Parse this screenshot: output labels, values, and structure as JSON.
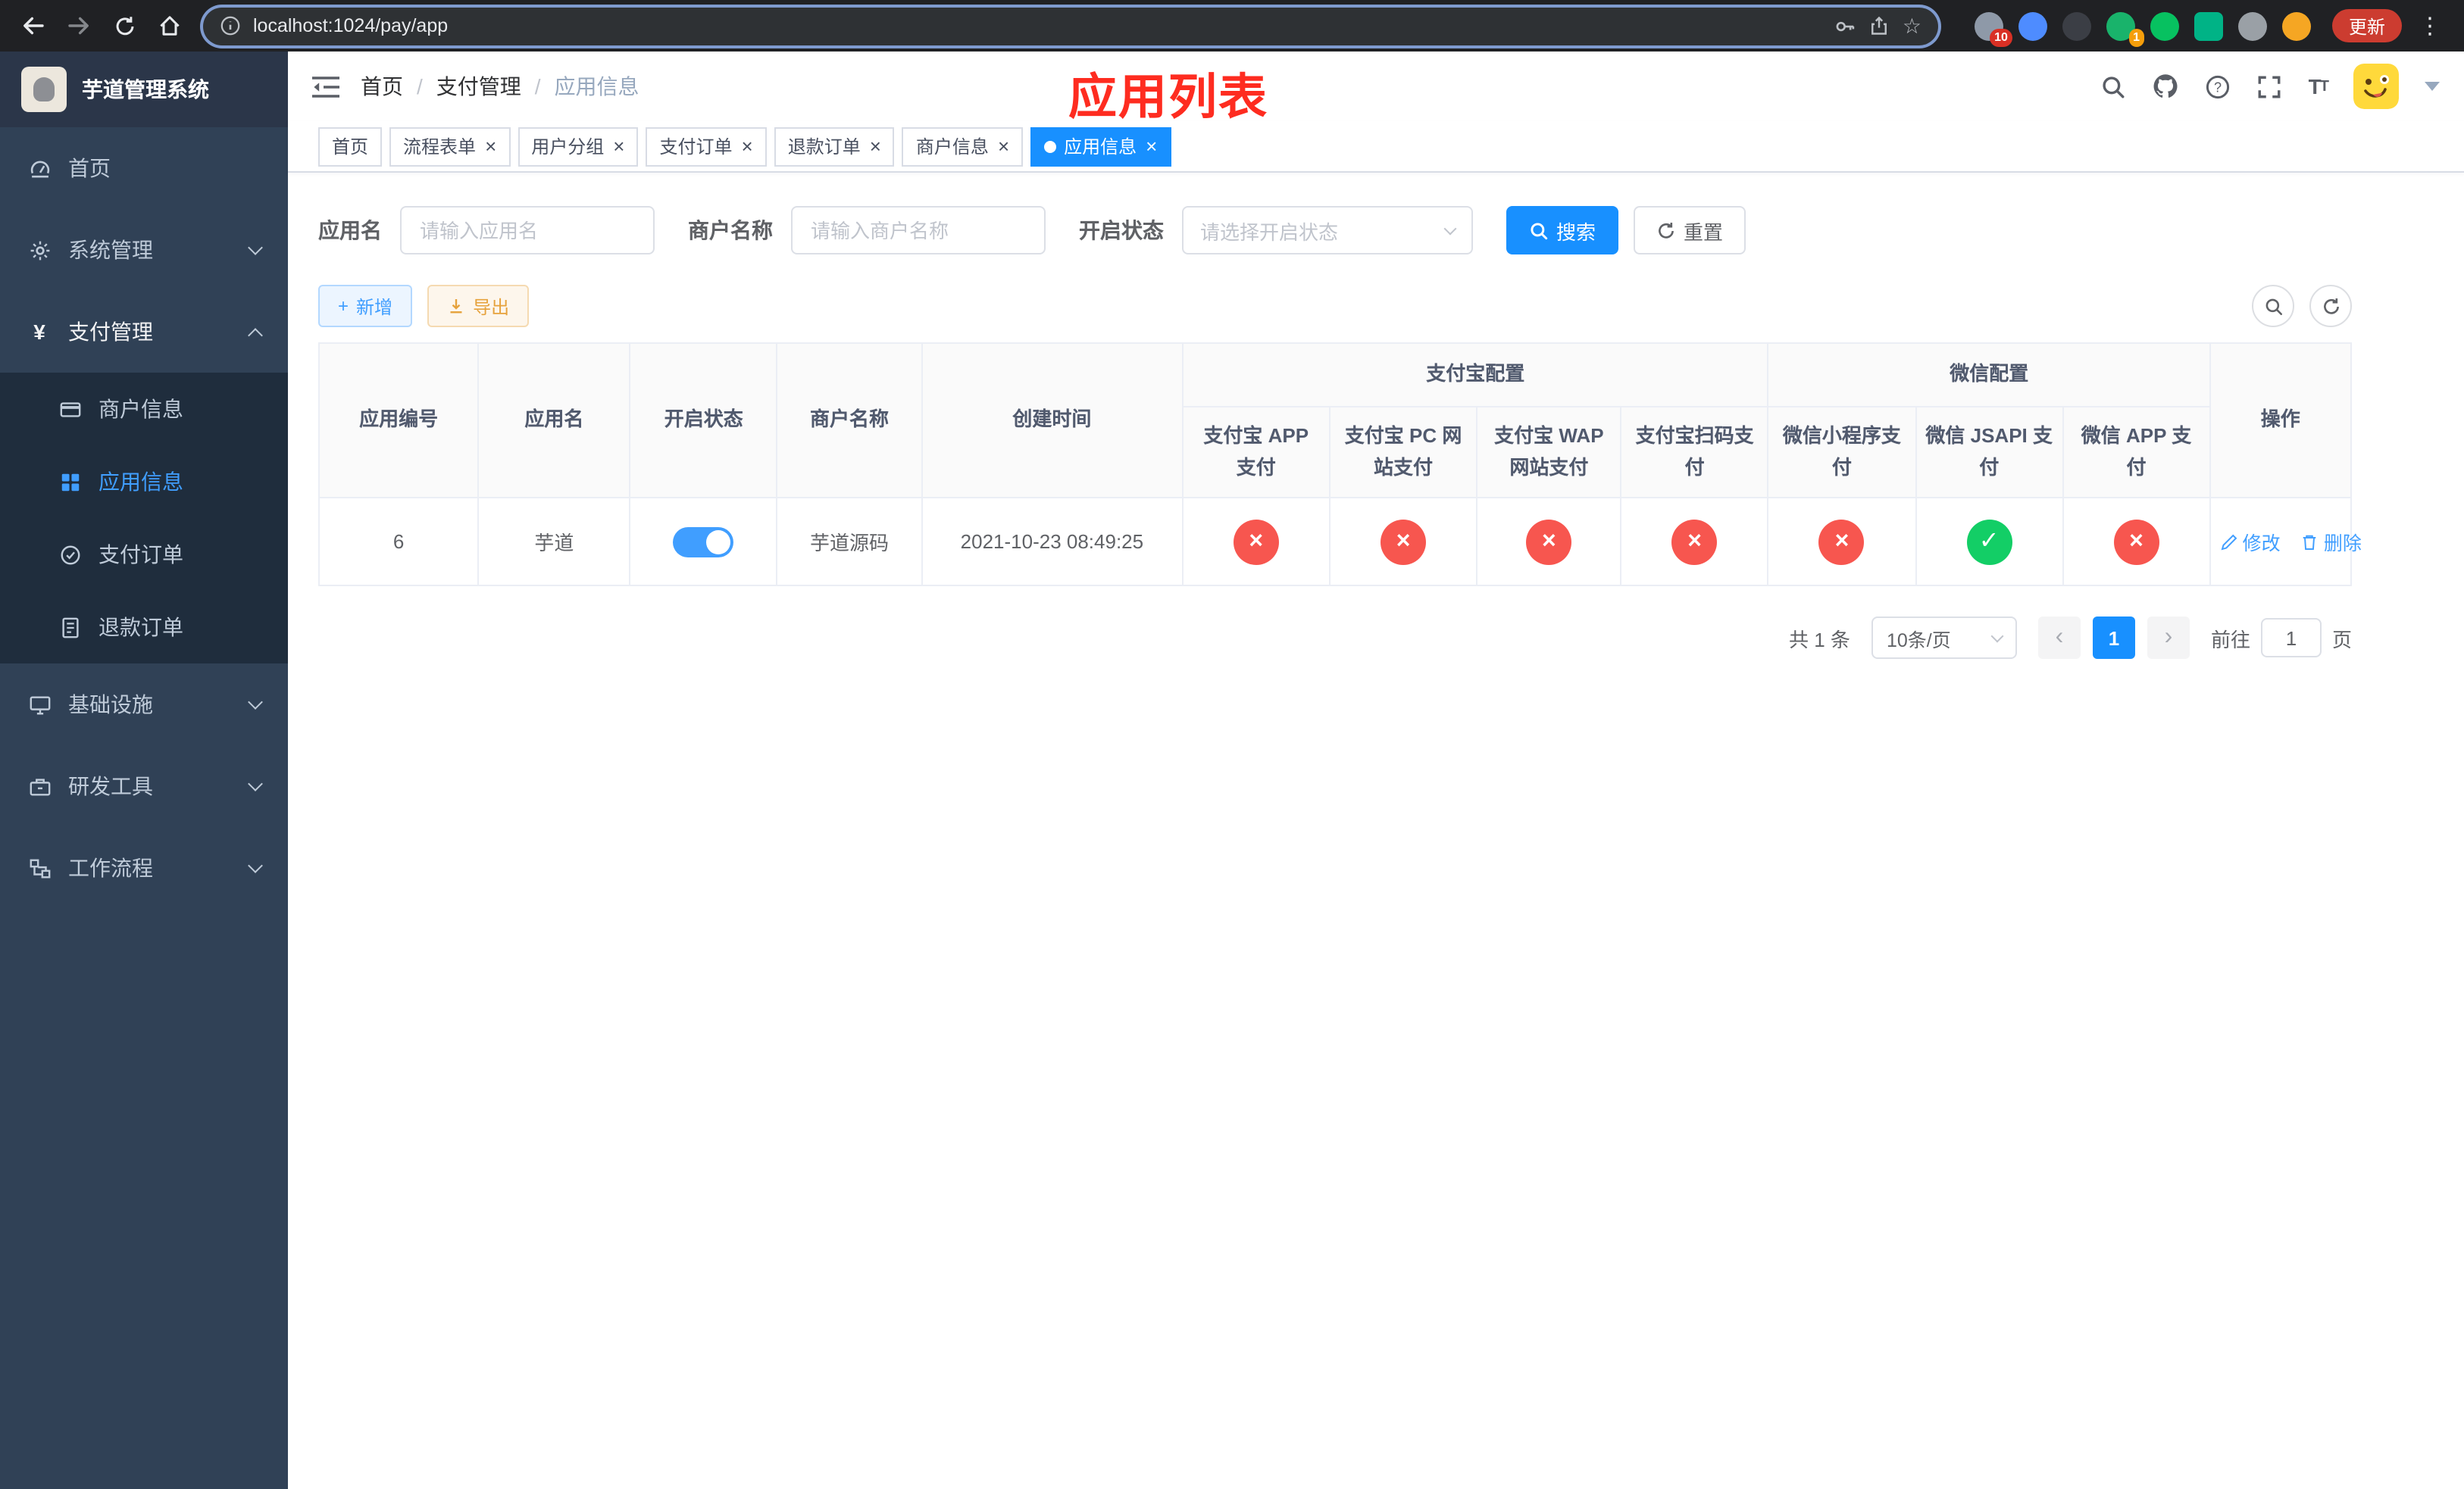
{
  "colors": {
    "primary": "#1890ff",
    "link": "#409eff",
    "success": "#13ce66",
    "danger": "#f7564f",
    "warning": "#e6a23c",
    "title_red": "#fe2c20",
    "sidebar_bg": "#304156",
    "submenu_bg": "#1f2d3d"
  },
  "browser": {
    "url": "localhost:1024/pay/app",
    "update_button": "更新",
    "extensions_badge": "10",
    "profile_badge": "1"
  },
  "app_title": "芋道管理系统",
  "sidebar": {
    "home": "首页",
    "system": "系统管理",
    "pay": "支付管理",
    "pay_children": {
      "merchant": "商户信息",
      "app": "应用信息",
      "order": "支付订单",
      "refund": "退款订单"
    },
    "infra": "基础设施",
    "devtool": "研发工具",
    "workflow": "工作流程"
  },
  "navbar": {
    "breadcrumb": [
      "首页",
      "支付管理",
      "应用信息"
    ],
    "page_title": "应用列表"
  },
  "tabs": [
    {
      "label": "首页",
      "active": false,
      "closable": false
    },
    {
      "label": "流程表单",
      "active": false,
      "closable": true
    },
    {
      "label": "用户分组",
      "active": false,
      "closable": true
    },
    {
      "label": "支付订单",
      "active": false,
      "closable": true
    },
    {
      "label": "退款订单",
      "active": false,
      "closable": true
    },
    {
      "label": "商户信息",
      "active": false,
      "closable": true
    },
    {
      "label": "应用信息",
      "active": true,
      "closable": true
    }
  ],
  "filters": {
    "app_name_label": "应用名",
    "app_name_placeholder": "请输入应用名",
    "app_name_value": "",
    "merchant_label": "商户名称",
    "merchant_placeholder": "请输入商户名称",
    "merchant_value": "",
    "status_label": "开启状态",
    "status_placeholder": "请选择开启状态",
    "search_button": "搜索",
    "reset_button": "重置"
  },
  "toolbar": {
    "add_button": "新增",
    "export_button": "导出"
  },
  "table": {
    "headers": {
      "app_id": "应用编号",
      "app_name": "应用名",
      "status": "开启状态",
      "merchant_name": "商户名称",
      "create_time": "创建时间",
      "alipay_group": "支付宝配置",
      "wechat_group": "微信配置",
      "alipay_app": "支付宝 APP 支付",
      "alipay_pc": "支付宝 PC 网站支付",
      "alipay_wap": "支付宝 WAP 网站支付",
      "alipay_qr": "支付宝扫码支付",
      "wx_mini": "微信小程序支付",
      "wx_jsapi": "微信 JSAPI 支付",
      "wx_app": "微信 APP 支付",
      "actions": "操作"
    },
    "rows": [
      {
        "app_id": "6",
        "app_name": "芋道",
        "status": "on",
        "merchant_name": "芋道源码",
        "create_time": "2021-10-23 08:49:25",
        "configs": {
          "alipay_app": "no",
          "alipay_pc": "no",
          "alipay_wap": "no",
          "alipay_qr": "no",
          "wx_mini": "no",
          "wx_jsapi": "yes",
          "wx_app": "no"
        },
        "edit_label": "修改",
        "delete_label": "删除"
      }
    ]
  },
  "pagination": {
    "total": "共 1 条",
    "page_size": "10条/页",
    "current_page": "1",
    "goto_label": "前往",
    "goto_value": "1",
    "goto_unit": "页"
  },
  "icons": {
    "browser": [
      "back-icon",
      "forward-icon",
      "reload-icon",
      "home-icon",
      "site-info-icon",
      "key-icon",
      "share-icon",
      "bookmark-star-icon",
      "extension-icon",
      "browser-menu-icon"
    ],
    "header": [
      "collapse-sidebar-icon",
      "search-icon",
      "github-icon",
      "help-icon",
      "fullscreen-icon",
      "font-size-icon",
      "user-avatar",
      "caret-down-icon"
    ],
    "sidebar": [
      "dashboard-icon",
      "gear-icon",
      "yen-icon",
      "credit-card-icon",
      "app-grid-icon",
      "pay-order-icon",
      "refund-doc-icon",
      "monitor-icon",
      "toolbox-icon",
      "workflow-icon"
    ],
    "table": [
      "toggle-switch",
      "cross-circle-icon",
      "check-circle-icon",
      "edit-pencil-icon",
      "delete-trash-icon"
    ]
  }
}
